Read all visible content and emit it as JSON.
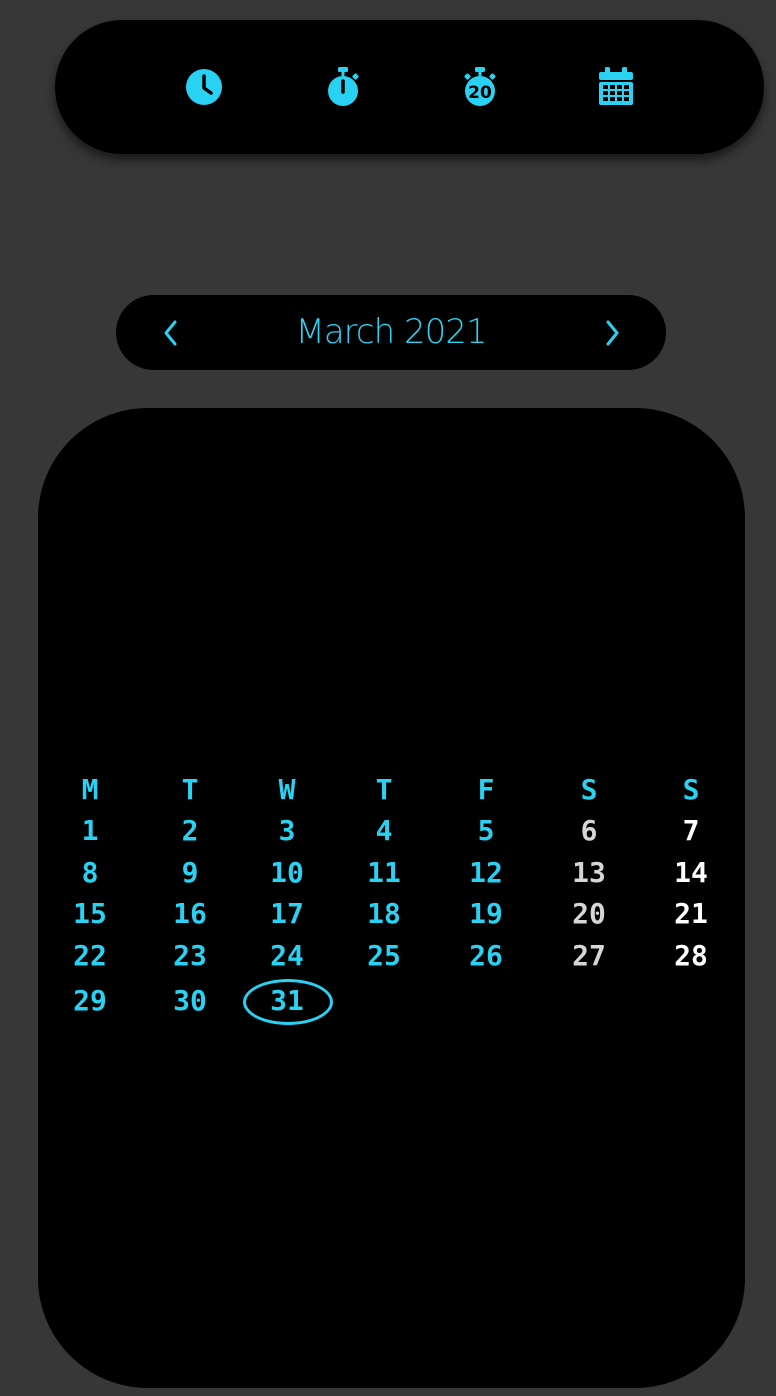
{
  "toolbar": {
    "items": [
      {
        "name": "clock-icon",
        "badge": ""
      },
      {
        "name": "stopwatch-icon",
        "badge": ""
      },
      {
        "name": "timer-icon",
        "badge": "20"
      },
      {
        "name": "calendar-icon",
        "badge": ""
      }
    ]
  },
  "month_nav": {
    "title": "March 2021",
    "prev_icon": "chevron-left-icon",
    "next_icon": "chevron-right-icon"
  },
  "calendar": {
    "weekdays": [
      "M",
      "T",
      "W",
      "T",
      "F",
      "S",
      "S"
    ],
    "weeks": [
      [
        "1",
        "2",
        "3",
        "4",
        "5",
        "6",
        "7"
      ],
      [
        "8",
        "9",
        "10",
        "11",
        "12",
        "13",
        "14"
      ],
      [
        "15",
        "16",
        "17",
        "18",
        "19",
        "20",
        "21"
      ],
      [
        "22",
        "23",
        "24",
        "25",
        "26",
        "27",
        "28"
      ],
      [
        "29",
        "30",
        "31",
        "",
        "",
        "",
        ""
      ]
    ],
    "today": "31"
  },
  "colors": {
    "accent": "#29d2f2",
    "saturday": "#d6d6d6",
    "sunday": "#ffffff",
    "background": "#373737",
    "panel": "#000000"
  }
}
